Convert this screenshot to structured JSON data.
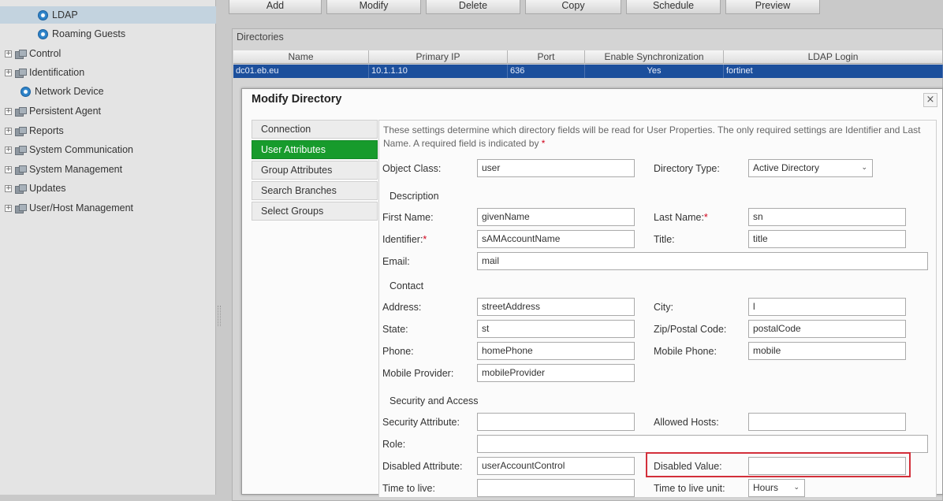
{
  "tree": {
    "items": [
      {
        "label": "LDAP",
        "icon": "gear-icon",
        "selected": true
      },
      {
        "label": "Roaming Guests",
        "icon": "gear-icon"
      },
      {
        "label": "Control",
        "icon": "folder-icon"
      },
      {
        "label": "Identification",
        "icon": "folder-icon"
      },
      {
        "label": "Network Device",
        "icon": "gear-icon"
      },
      {
        "label": "Persistent Agent",
        "icon": "folder-icon"
      },
      {
        "label": "Reports",
        "icon": "folder-icon"
      },
      {
        "label": "System Communication",
        "icon": "folder-icon"
      },
      {
        "label": "System Management",
        "icon": "folder-icon"
      },
      {
        "label": "Updates",
        "icon": "folder-icon"
      },
      {
        "label": "User/Host Management",
        "icon": "folder-icon"
      }
    ]
  },
  "toolbar": {
    "buttons": [
      "Add",
      "Modify",
      "Delete",
      "Copy",
      "Schedule",
      "Preview"
    ]
  },
  "directories": {
    "title": "Directories",
    "columns": [
      "Name",
      "Primary IP",
      "Port",
      "Enable Synchronization",
      "LDAP Login"
    ],
    "rows": [
      [
        "dc01.eb.eu",
        "10.1.1.10",
        "636",
        "Yes",
        "fortinet"
      ]
    ]
  },
  "modal": {
    "title": "Modify Directory",
    "close_glyph": "×",
    "tabs": [
      "Connection",
      "User Attributes",
      "Group Attributes",
      "Search Branches",
      "Select Groups"
    ],
    "active_tab": "User Attributes",
    "intro": "These settings determine which directory fields will be read for User Properties. The only required settings are Identifier and Last Name. A required field is indicated by",
    "intro_marker": "*",
    "object_class": {
      "label": "Object Class:",
      "value": "user"
    },
    "directory_type": {
      "label": "Directory Type:",
      "value": "Active Directory"
    },
    "description": {
      "title": "Description",
      "first_name": {
        "label": "First Name:",
        "value": "givenName"
      },
      "last_name": {
        "label": "Last Name:",
        "value": "sn",
        "required": "*"
      },
      "identifier": {
        "label": "Identifier:",
        "value": "sAMAccountName",
        "required": "*"
      },
      "title_field": {
        "label": "Title:",
        "value": "title"
      },
      "email": {
        "label": "Email:",
        "value": "mail"
      }
    },
    "contact": {
      "title": "Contact",
      "address": {
        "label": "Address:",
        "value": "streetAddress"
      },
      "city": {
        "label": "City:",
        "value": "l"
      },
      "state": {
        "label": "State:",
        "value": "st"
      },
      "zip": {
        "label": "Zip/Postal Code:",
        "value": "postalCode"
      },
      "phone": {
        "label": "Phone:",
        "value": "homePhone"
      },
      "mobile_phone": {
        "label": "Mobile Phone:",
        "value": "mobile"
      },
      "mobile_provider": {
        "label": "Mobile Provider:",
        "value": "mobileProvider"
      }
    },
    "security": {
      "title": "Security and Access",
      "security_attribute": {
        "label": "Security Attribute:",
        "value": ""
      },
      "allowed_hosts": {
        "label": "Allowed Hosts:",
        "value": ""
      },
      "role": {
        "label": "Role:",
        "value": ""
      },
      "disabled_attribute": {
        "label": "Disabled Attribute:",
        "value": "userAccountControl"
      },
      "disabled_value": {
        "label": "Disabled Value:",
        "value": ""
      },
      "time_to_live": {
        "label": "Time to live:",
        "value": ""
      },
      "time_to_live_unit": {
        "label": "Time to live unit:",
        "value": "Hours"
      }
    }
  },
  "colors": {
    "active_tab": "#179b2c",
    "selected_row": "#1c4f9c",
    "highlight_box": "#d32f3a",
    "required_marker": "#d0021b"
  }
}
